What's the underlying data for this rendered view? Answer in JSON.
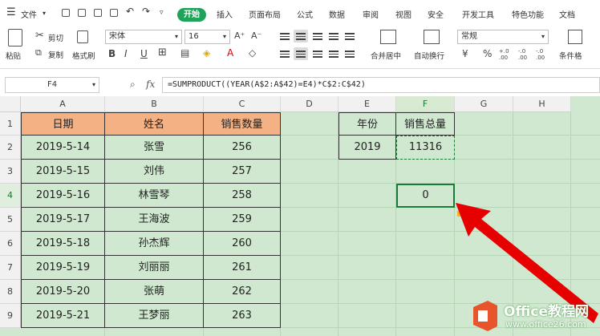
{
  "menu": {
    "file": "文件",
    "tabs": [
      "开始",
      "插入",
      "页面布局",
      "公式",
      "数据",
      "审阅",
      "视图",
      "安全",
      "开发工具",
      "特色功能",
      "文档"
    ]
  },
  "ribbon": {
    "paste": "粘贴",
    "cut": "剪切",
    "copy": "复制",
    "format_painter": "格式刷",
    "font_name": "宋体",
    "font_size": "16",
    "merge_center": "合并居中",
    "auto_wrap": "自动换行",
    "number_format": "常规",
    "currency_symbol": "¥",
    "percent_symbol": "%",
    "decimal_inc": "+.0 .00",
    "decimal_dec": "-.0 .00",
    "condition": "条件格"
  },
  "formula_bar": {
    "cell_ref": "F4",
    "fx": "fx",
    "formula": "=SUMPRODUCT((YEAR(A$2:A$42)=E4)*C$2:C$42)"
  },
  "columns": [
    "A",
    "B",
    "C",
    "D",
    "E",
    "F",
    "G",
    "H"
  ],
  "rows": [
    "1",
    "2",
    "3",
    "4",
    "5",
    "6",
    "7",
    "8",
    "9"
  ],
  "table": {
    "headers": [
      "日期",
      "姓名",
      "销售数量"
    ],
    "rows": [
      [
        "2019-5-14",
        "张雪",
        "256"
      ],
      [
        "2019-5-15",
        "刘伟",
        "257"
      ],
      [
        "2019-5-16",
        "林雪琴",
        "258"
      ],
      [
        "2019-5-17",
        "王海波",
        "259"
      ],
      [
        "2019-5-18",
        "孙杰辉",
        "260"
      ],
      [
        "2019-5-19",
        "刘丽丽",
        "261"
      ],
      [
        "2019-5-20",
        "张萌",
        "262"
      ],
      [
        "2019-5-21",
        "王梦丽",
        "263"
      ]
    ]
  },
  "side_table": {
    "year_label": "年份",
    "total_label": "销售总量",
    "year_value": "2019",
    "total_value": "11316",
    "f4_value": "0"
  },
  "watermark": {
    "brand": "Office教程网",
    "url": "www.office26.com"
  },
  "colors": {
    "accent_green": "#1ea35a",
    "header_fill": "#f4b183",
    "sheet_bg": "#cfe8cf",
    "arrow_red": "#e60000"
  }
}
